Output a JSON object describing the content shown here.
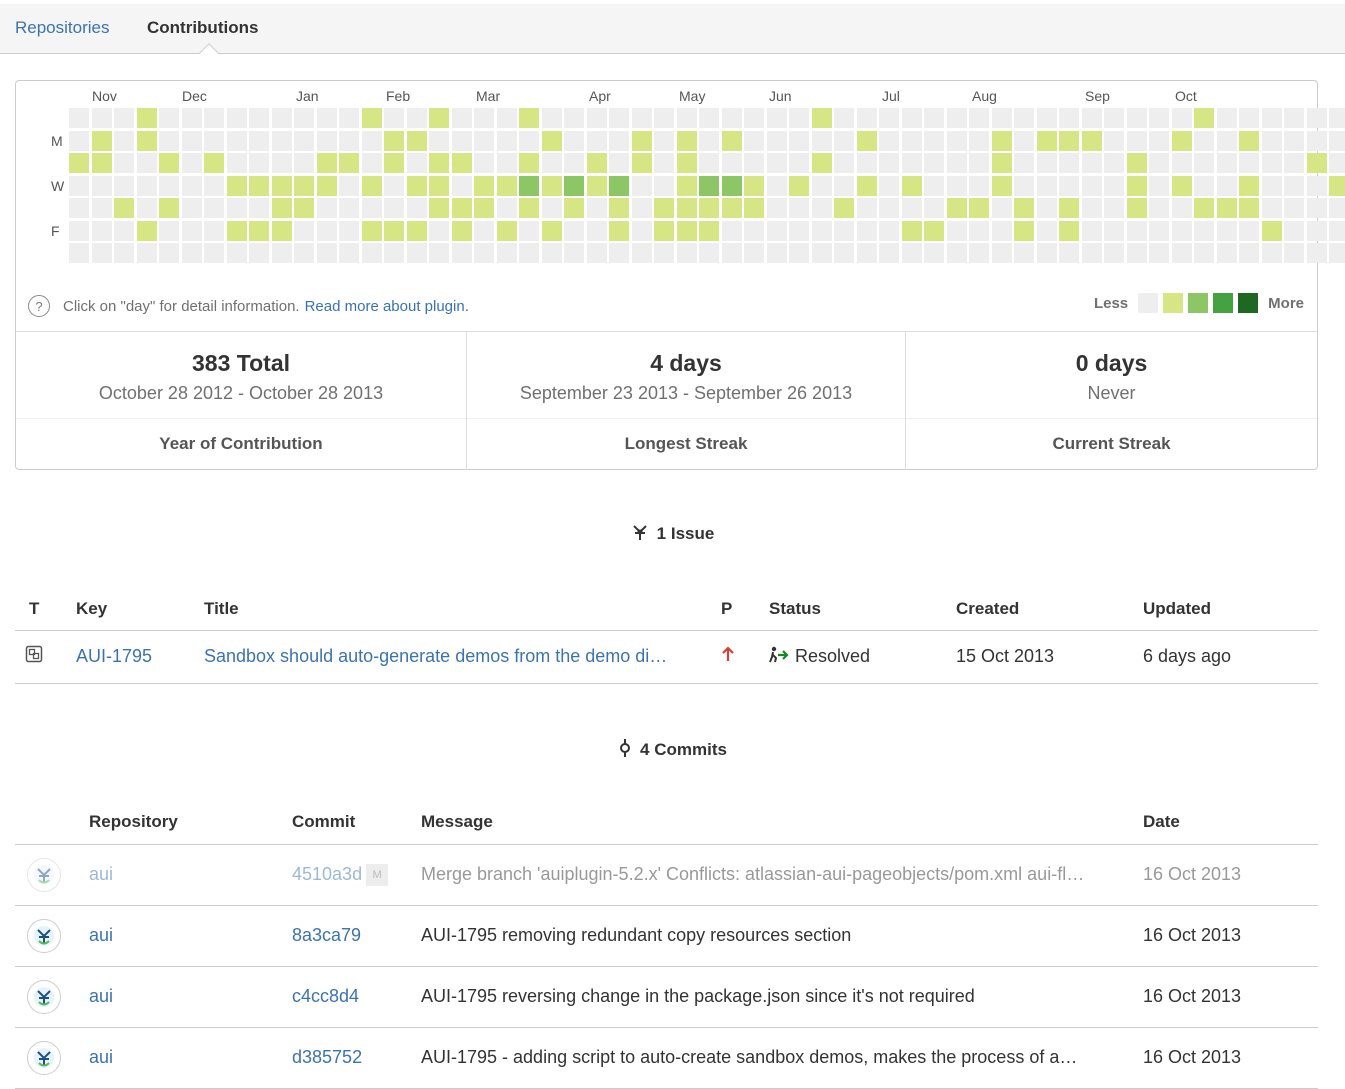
{
  "tabs": [
    {
      "label": "Repositories",
      "active": false
    },
    {
      "label": "Contributions",
      "active": true
    }
  ],
  "calendar": {
    "months": [
      "Nov",
      "Dec",
      "Jan",
      "Feb",
      "Mar",
      "Apr",
      "May",
      "Jun",
      "Jul",
      "Aug",
      "Sep",
      "Oct"
    ],
    "day_labels": [
      "M",
      "W",
      "F"
    ],
    "levels": [
      "0001000000000100100010000000000001000000000000000010000000",
      "0101000000000011000001000101010000010000010111000100100000",
      "1100101000011010110010010101000001000000010000010000000101",
      "0000000111110101101121212001221010010100010000010100100011",
      "0010100001100000111010101011111000100001101010010011100001",
      "0001000111000111010101001011100000000110001010000000010000",
      "000000000000000000000000000000000000000000000000000000000"
    ],
    "colors": [
      "#eeeeee",
      "#d6e685",
      "#8cc665",
      "#44a340",
      "#1e6823"
    ],
    "hint_text": "Click on \"day\" for detail information.",
    "hint_link": "Read more about plugin.",
    "legend_less": "Less",
    "legend_more": "More"
  },
  "stats": [
    {
      "value": "383 Total",
      "range": "October 28 2012 - October 28 2013",
      "label": "Year of Contribution"
    },
    {
      "value": "4 days",
      "range": "September 23 2013 - September 26 2013",
      "label": "Longest Streak"
    },
    {
      "value": "0 days",
      "range": "Never",
      "label": "Current Streak"
    }
  ],
  "issues": {
    "heading": "1 Issue",
    "headers": {
      "t": "T",
      "key": "Key",
      "title": "Title",
      "p": "P",
      "status": "Status",
      "created": "Created",
      "updated": "Updated"
    },
    "rows": [
      {
        "type_icon": "issue-type-icon",
        "key": "AUI-1795",
        "title": "Sandbox should auto-generate demos from the demo di…",
        "priority_icon": "priority-up-arrow-icon",
        "status": "Resolved",
        "created": "15 Oct 2013",
        "updated": "6 days ago"
      }
    ]
  },
  "commits": {
    "heading": "4 Commits",
    "headers": {
      "repository": "Repository",
      "commit": "Commit",
      "message": "Message",
      "date": "Date"
    },
    "rows": [
      {
        "repo": "aui",
        "hash": "4510a3d",
        "merge_badge": "M",
        "message": "Merge branch 'auiplugin-5.2.x' Conflicts: atlassian-aui-pageobjects/pom.xml aui-fl…",
        "date": "16 Oct 2013",
        "faded": true
      },
      {
        "repo": "aui",
        "hash": "8a3ca79",
        "merge_badge": "",
        "message": "AUI-1795 removing redundant copy resources section",
        "date": "16 Oct 2013",
        "faded": false
      },
      {
        "repo": "aui",
        "hash": "c4cc8d4",
        "merge_badge": "",
        "message": "AUI-1795 reversing change in the package.json since it's not required",
        "date": "16 Oct 2013",
        "faded": false
      },
      {
        "repo": "aui",
        "hash": "d385752",
        "merge_badge": "",
        "message": "AUI-1795 - adding script to auto-create sandbox demos, makes the process of a…",
        "date": "16 Oct 2013",
        "faded": false
      }
    ]
  }
}
